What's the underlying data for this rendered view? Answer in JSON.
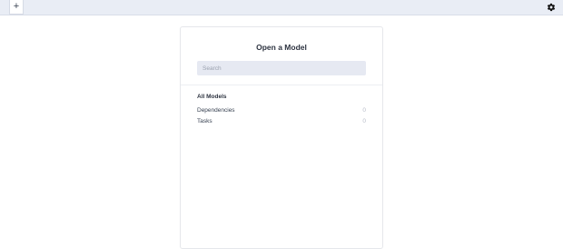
{
  "toolbar": {
    "add_icon": "+",
    "settings_icon_name": "gear-icon"
  },
  "panel": {
    "title": "Open a Model",
    "search": {
      "placeholder": "Search",
      "value": ""
    },
    "section_heading": "All Models",
    "models": [
      {
        "name": "Dependencies",
        "count": "0"
      },
      {
        "name": "Tasks",
        "count": "0"
      }
    ]
  },
  "colors": {
    "topbar_bg": "#e9edf5",
    "search_bg": "#e6e9f2",
    "title_text": "#2d3340",
    "count_text": "#b6bcc7"
  }
}
